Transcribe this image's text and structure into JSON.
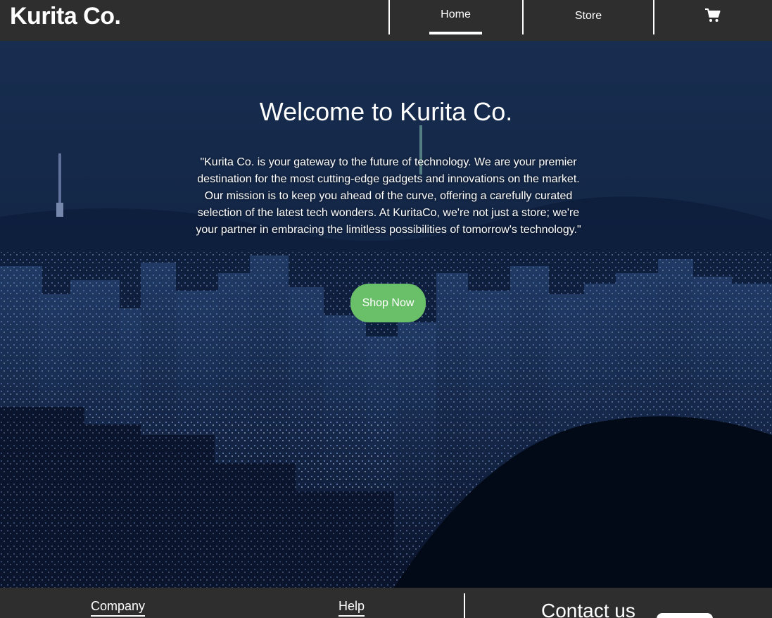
{
  "navbar": {
    "brand": "Kurita Co.",
    "links": [
      {
        "label": "Home",
        "active": true
      },
      {
        "label": "Store",
        "active": false
      }
    ],
    "cart_icon": "shopping-cart-icon"
  },
  "hero": {
    "title": "Welcome to Kurita Co.",
    "description": "\"Kurita Co. is your gateway to the future of technology. We are your premier destination for the most cutting-edge gadgets and innovations on the market. Our mission is to keep you ahead of the curve, offering a carefully curated selection of the latest tech wonders. At KuritaCo, we're not just a store; we're your partner in embracing the limitless possibilities of tomorrow's technology.\"",
    "button_label": "Shop Now",
    "background": "night-city-skyline-image"
  },
  "footer": {
    "company_heading": "Company",
    "help_heading": "Help",
    "contact_heading": "Contact us"
  },
  "colors": {
    "navbar_bg": "#2e2e2e",
    "accent_button": "#6abf69",
    "text": "#ffffff"
  }
}
